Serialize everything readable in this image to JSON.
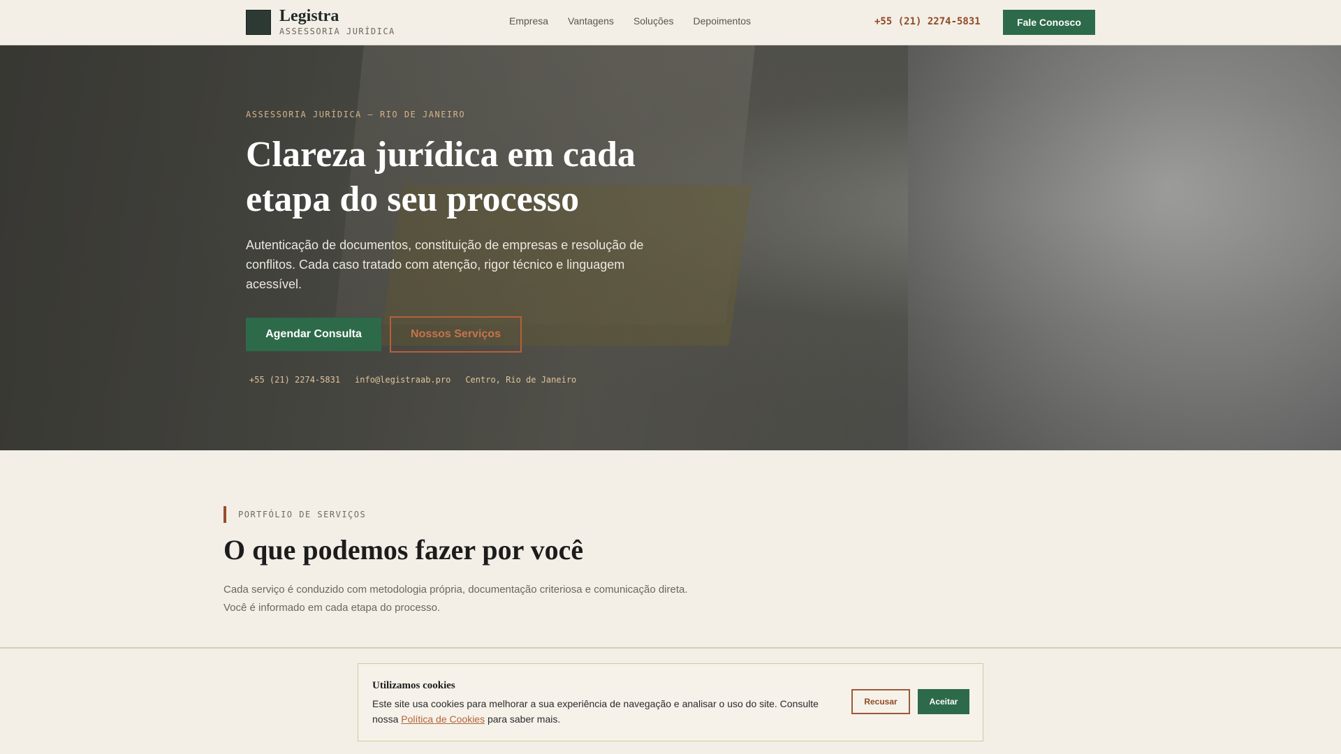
{
  "header": {
    "logo_glyph": "",
    "brand_name": "Legistra",
    "brand_subtitle": "ASSESSORIA JURÍDICA",
    "nav": [
      "Empresa",
      "Vantagens",
      "Soluções",
      "Depoimentos"
    ],
    "phone_icon": "",
    "phone": "+55 (21) 2274-5831",
    "cta_label": "Fale Conosco"
  },
  "hero": {
    "kicker_icon": "",
    "kicker": "ASSESSORIA JURÍDICA — RIO DE JANEIRO",
    "title": "Clareza jurídica em cada etapa do seu processo",
    "text": "Autenticação de documentos, constituição de empresas e resolução de conflitos. Cada caso tratado com atenção, rigor técnico e linguagem acessível.",
    "primary_button": "Agendar Consulta",
    "secondary_button": "Nossos Serviços",
    "contacts": [
      {
        "icon": "",
        "icon_name": "phone-icon",
        "text": "+55 (21) 2274-5831"
      },
      {
        "icon": "",
        "icon_name": "mail-icon",
        "text": "info@legistraab.pro"
      },
      {
        "icon": "",
        "icon_name": "map-pin-icon",
        "text": "Centro, Rio de Janeiro"
      }
    ]
  },
  "services": {
    "kicker": "PORTFÓLIO DE SERVIÇOS",
    "title": "O que podemos fazer por você",
    "text": "Cada serviço é conduzido com metodologia própria, documentação criteriosa e comunicação direta. Você é informado em cada etapa do processo."
  },
  "cookie": {
    "title": "Utilizamos cookies",
    "text_before": "Este site usa cookies para melhorar a sua experiência de navegação e analisar o uso do site. Consulte nossa ",
    "link": "Política de Cookies",
    "text_after": " para saber mais.",
    "decline": "Recusar",
    "accept": "Aceitar"
  },
  "colors": {
    "accent_green": "#2d6a4a",
    "accent_rust": "#8f4a26",
    "background": "#f3efe7"
  }
}
